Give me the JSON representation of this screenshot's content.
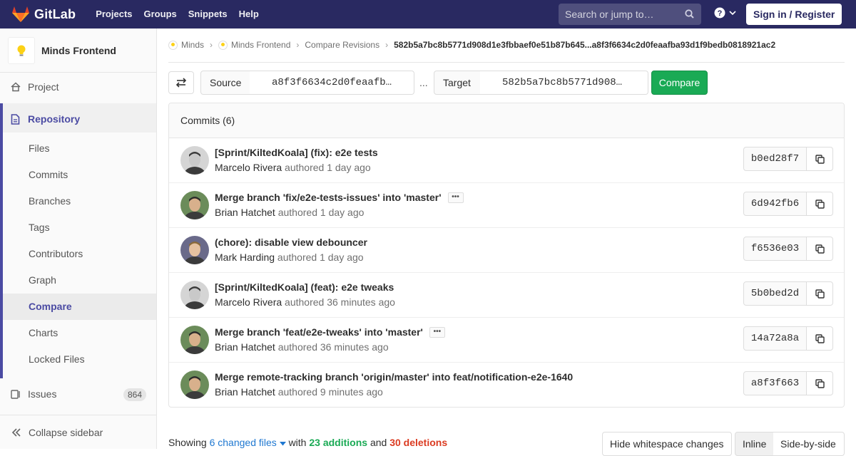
{
  "navbar": {
    "brand": "GitLab",
    "links": [
      "Projects",
      "Groups",
      "Snippets",
      "Help"
    ],
    "search_placeholder": "Search or jump to…",
    "signin": "Sign in / Register",
    "brand_color": "#292961"
  },
  "sidebar": {
    "project_name": "Minds Frontend",
    "project": "Project",
    "repository": "Repository",
    "repo_items": [
      "Files",
      "Commits",
      "Branches",
      "Tags",
      "Contributors",
      "Graph",
      "Compare",
      "Charts",
      "Locked Files"
    ],
    "active_item": "Compare",
    "issues": "Issues",
    "issues_count": "864",
    "collapse": "Collapse sidebar"
  },
  "breadcrumb": {
    "items": [
      "Minds",
      "Minds Frontend",
      "Compare Revisions"
    ],
    "current": "582b5a7bc8b5771d908d1e3fbbaef0e51b87b645...a8f3f6634c2d0feaafba93d1f9bedb0818921ac2"
  },
  "compare_form": {
    "source_label": "Source",
    "source_value": "a8f3f6634c2d0feaafb…",
    "separator": "...",
    "target_label": "Target",
    "target_value": "582b5a7bc8b5771d908…",
    "compare_button": "Compare"
  },
  "commits": {
    "header": "Commits (6)",
    "items": [
      {
        "title": "[Sprint/KiltedKoala] (fix): e2e tests",
        "author": "Marcelo Rivera",
        "authored": "authored",
        "time": "1 day ago",
        "sha": "b0ed28f7",
        "has_ellipsis": false
      },
      {
        "title": "Merge branch 'fix/e2e-tests-issues' into 'master'",
        "author": "Brian Hatchet",
        "authored": "authored",
        "time": "1 day ago",
        "sha": "6d942fb6",
        "has_ellipsis": true
      },
      {
        "title": "(chore): disable view debouncer",
        "author": "Mark Harding",
        "authored": "authored",
        "time": "1 day ago",
        "sha": "f6536e03",
        "has_ellipsis": false
      },
      {
        "title": "[Sprint/KiltedKoala] (feat): e2e tweaks",
        "author": "Marcelo Rivera",
        "authored": "authored",
        "time": "36 minutes ago",
        "sha": "5b0bed2d",
        "has_ellipsis": false
      },
      {
        "title": "Merge branch 'feat/e2e-tweaks' into 'master'",
        "author": "Brian Hatchet",
        "authored": "authored",
        "time": "36 minutes ago",
        "sha": "14a72a8a",
        "has_ellipsis": true
      },
      {
        "title": "Merge remote-tracking branch 'origin/master' into feat/notification-e2e-1640",
        "author": "Brian Hatchet",
        "authored": "authored",
        "time": "9 minutes ago",
        "sha": "a8f3f663",
        "has_ellipsis": false
      }
    ]
  },
  "diff_summary": {
    "showing": "Showing",
    "changed_files": "6 changed files",
    "with": "with",
    "additions": "23 additions",
    "and": "and",
    "deletions": "30 deletions",
    "hide_whitespace": "Hide whitespace changes",
    "inline": "Inline",
    "side_by_side": "Side-by-side"
  }
}
